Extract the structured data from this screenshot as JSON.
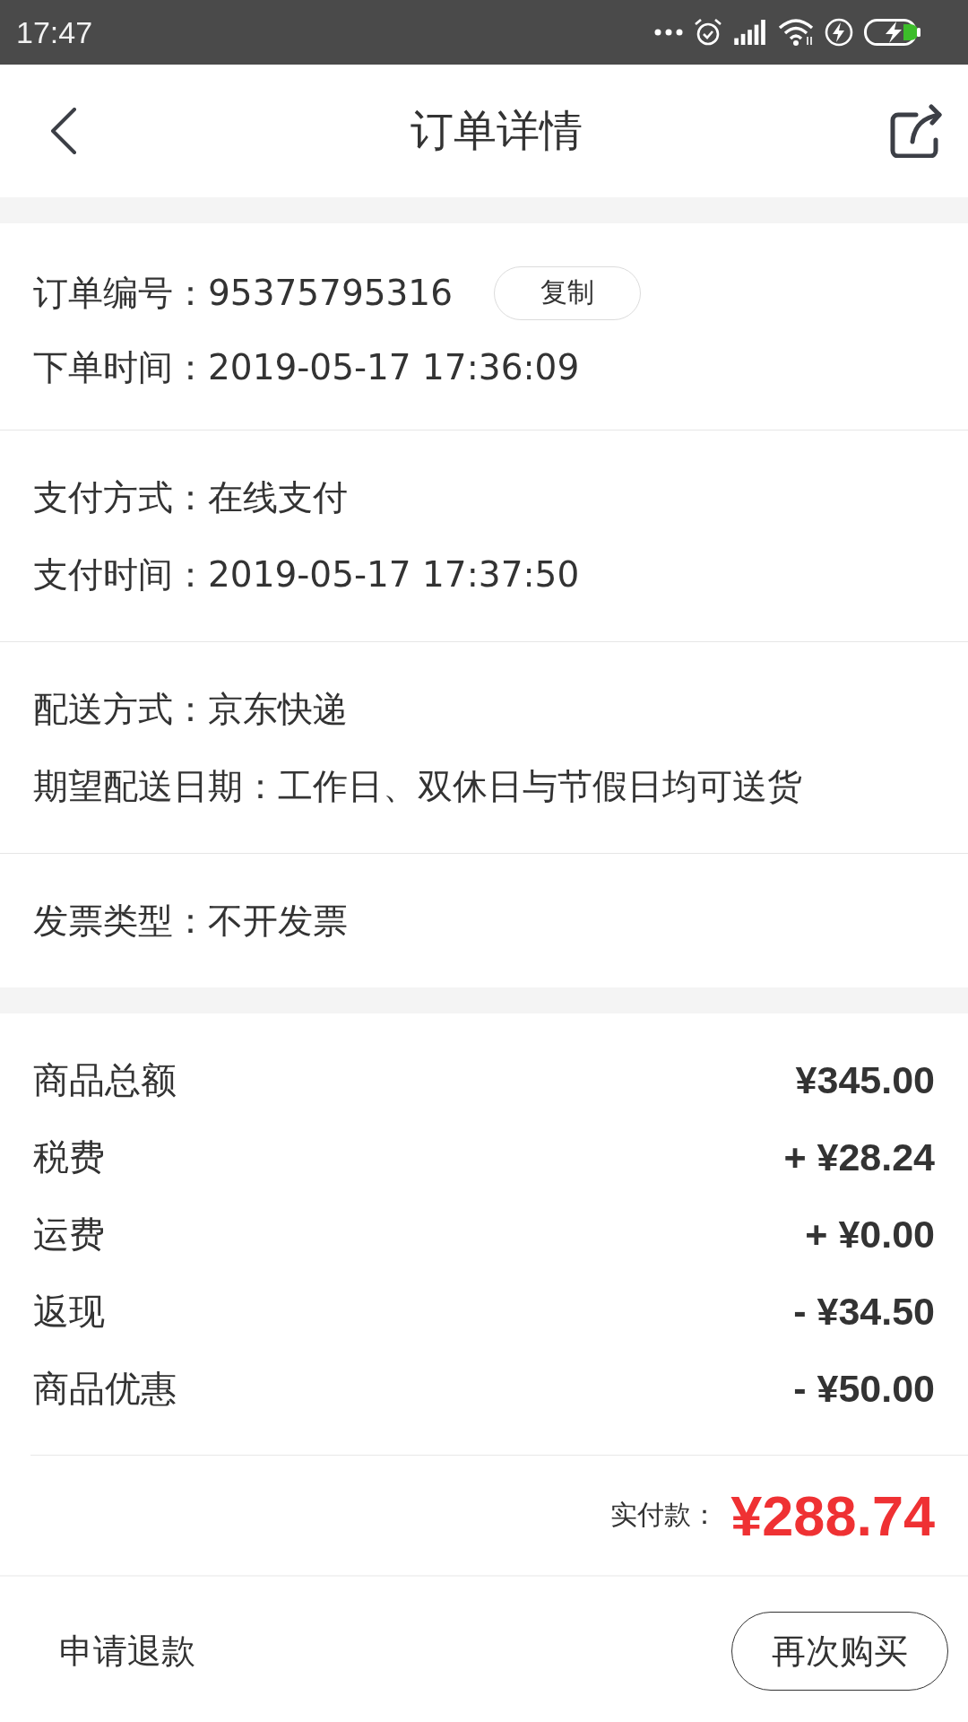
{
  "status_bar": {
    "time": "17:47"
  },
  "header": {
    "title": "订单详情"
  },
  "info_sections": [
    {
      "rows": [
        {
          "text": "订单编号：95375795316",
          "action": "复制"
        },
        {
          "text": "下单时间：2019-05-17 17:36:09"
        }
      ]
    },
    {
      "rows": [
        {
          "text": "支付方式：在线支付"
        },
        {
          "text": "支付时间：2019-05-17 17:37:50"
        }
      ]
    },
    {
      "rows": [
        {
          "text": "配送方式：京东快递"
        },
        {
          "text": "期望配送日期：工作日、双休日与节假日均可送货"
        }
      ]
    },
    {
      "rows": [
        {
          "text": "发票类型：不开发票"
        }
      ]
    }
  ],
  "totals": {
    "rows": [
      {
        "label": "商品总额",
        "amount": "¥345.00"
      },
      {
        "label": "税费",
        "amount": "+ ¥28.24"
      },
      {
        "label": "运费",
        "amount": "+ ¥0.00"
      },
      {
        "label": "返现",
        "amount": "- ¥34.50"
      },
      {
        "label": "商品优惠",
        "amount": "- ¥50.00"
      }
    ],
    "paid": {
      "label": "实付款：",
      "amount": "¥288.74"
    }
  },
  "footer": {
    "link": "申请退款",
    "button": "再次购买"
  }
}
